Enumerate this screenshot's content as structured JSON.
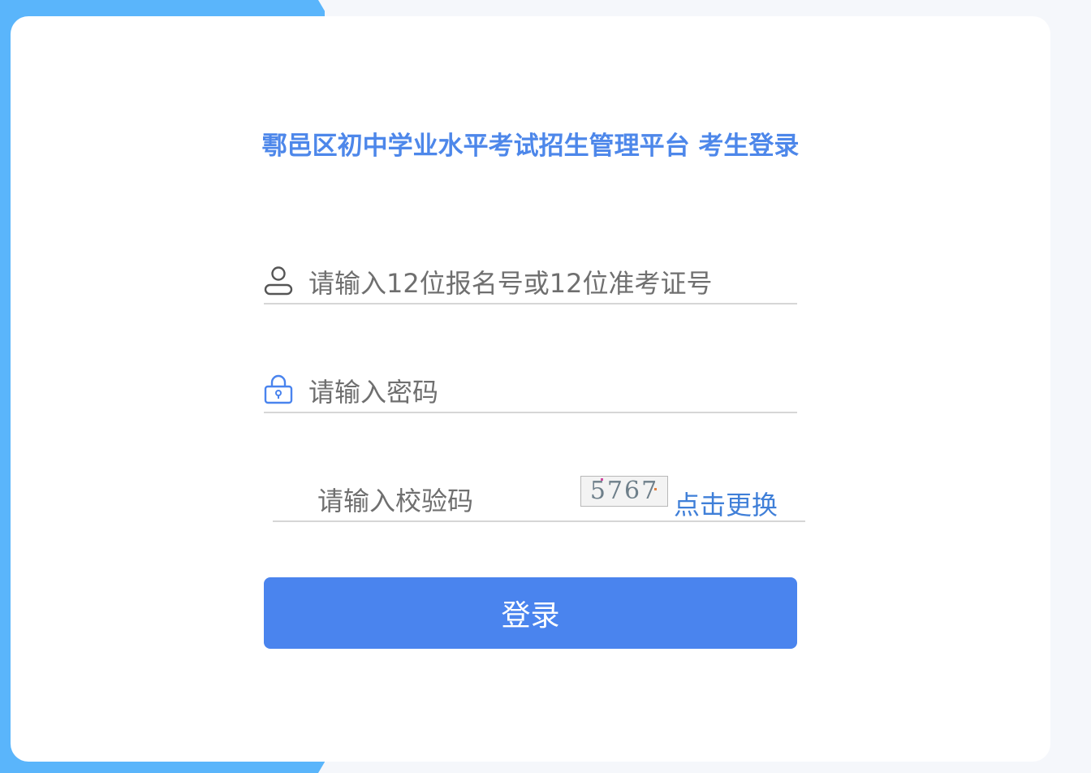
{
  "title": "鄠邑区初中学业水平考试招生管理平台 考生登录",
  "username": {
    "placeholder": "请输入12位报名号或12位准考证号",
    "icon": "user-icon"
  },
  "password": {
    "placeholder": "请输入密码",
    "icon": "lock-icon"
  },
  "captcha": {
    "placeholder": "请输入校验码",
    "image_text": "5767",
    "refresh_label": "点击更换"
  },
  "login_button": {
    "label": "登录"
  },
  "colors": {
    "accent": "#4a84ee",
    "title": "#4d87ea",
    "side_panel": "#5ab5fb"
  }
}
